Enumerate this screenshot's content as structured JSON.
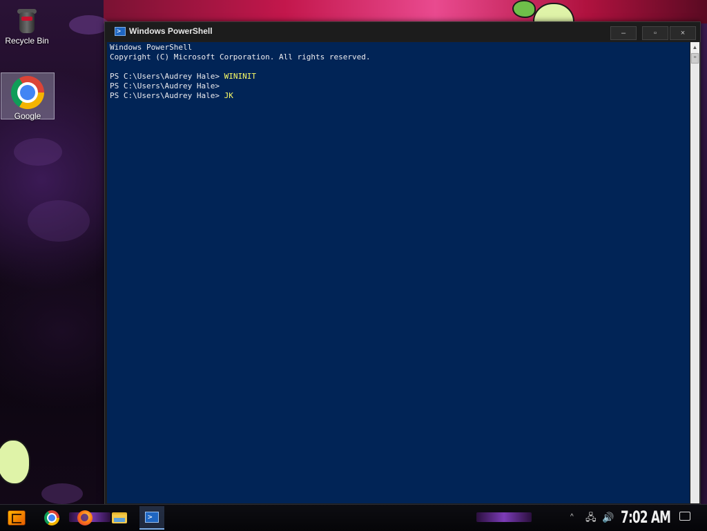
{
  "desktop": {
    "icons": [
      {
        "label": "Recycle Bin",
        "icon": "recycle-bin-icon"
      },
      {
        "label": "Google",
        "icon": "chrome-icon"
      }
    ]
  },
  "window": {
    "title": "Windows PowerShell",
    "icon": "powershell-icon",
    "controls": {
      "minimize": "–",
      "maximize": "▫",
      "close": "×"
    },
    "console": {
      "banner_line1": "Windows PowerShell",
      "banner_line2": "Copyright (C) Microsoft Corporation. All rights reserved.",
      "lines": [
        {
          "prompt": "PS C:\\Users\\Audrey Hale> ",
          "command": "WININIT"
        },
        {
          "prompt": "PS C:\\Users\\Audrey Hale> ",
          "command": ""
        },
        {
          "prompt": "PS C:\\Users\\Audrey Hale> ",
          "command": "JK"
        }
      ],
      "background": "#012456",
      "command_color": "#ffff66"
    }
  },
  "taskbar": {
    "apps": [
      "start-icon",
      "chrome-icon",
      "firefox-icon",
      "file-explorer-icon",
      "powershell-icon"
    ],
    "active_app": "powershell-icon",
    "tray": {
      "chevron": "^",
      "network_icon": "network-icon",
      "volume_icon": "volume-icon",
      "time": "7:02 AM",
      "notification_icon": "action-center-icon"
    }
  }
}
